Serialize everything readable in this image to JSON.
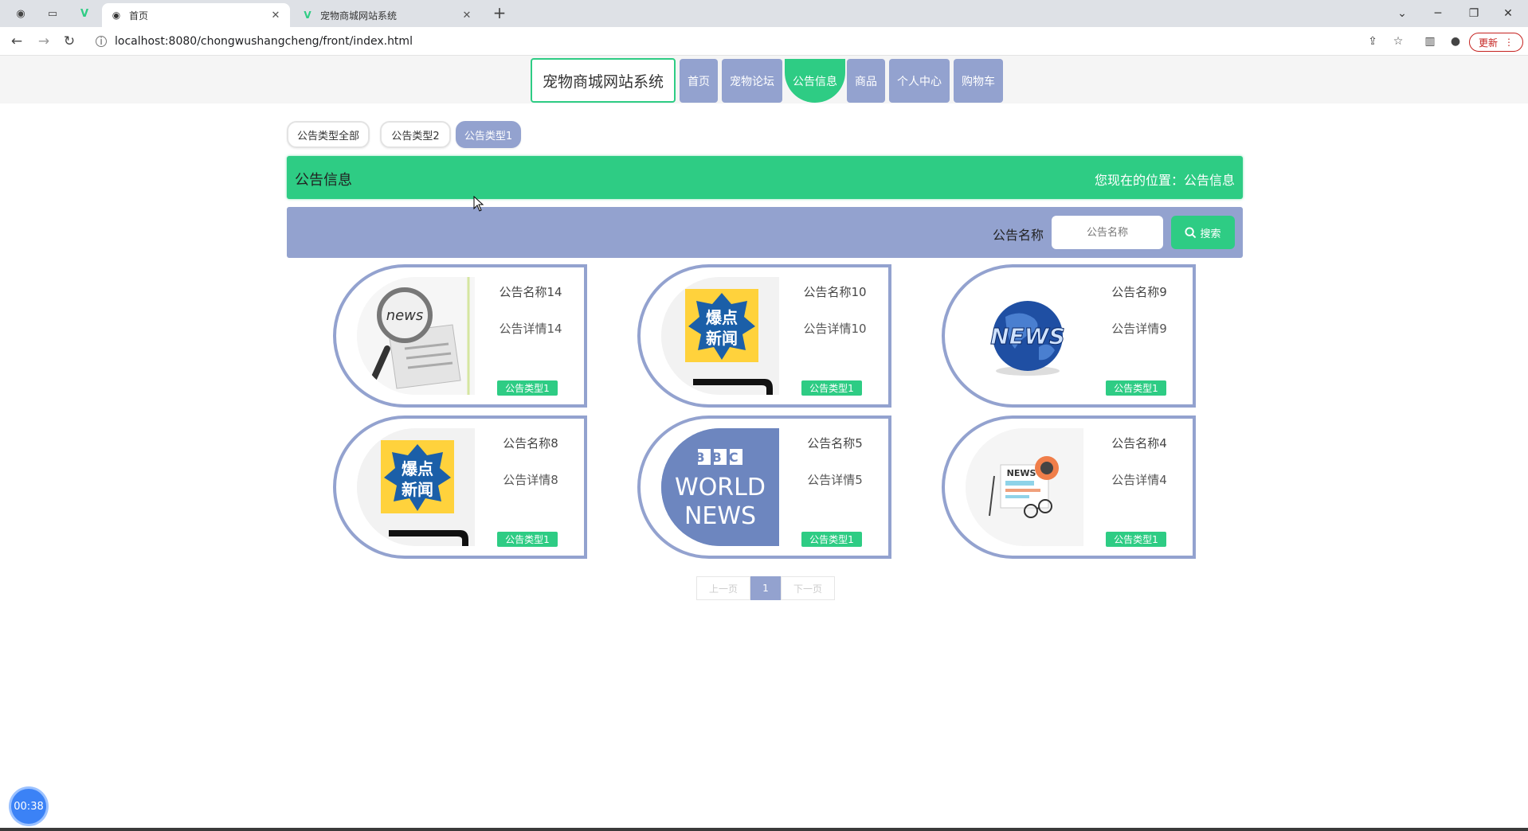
{
  "browser": {
    "tabs": [
      {
        "title": "首页",
        "active": true
      },
      {
        "title": "宠物商城网站系统",
        "active": false
      }
    ],
    "url": "localhost:8080/chongwushangcheng/front/index.html",
    "update_label": "更新"
  },
  "header": {
    "brand": "宠物商城网站系统",
    "menu": [
      {
        "label": "首页",
        "active": false
      },
      {
        "label": "宠物论坛",
        "active": false
      },
      {
        "label": "公告信息",
        "active": true
      },
      {
        "label": "商品",
        "active": false
      },
      {
        "label": "个人中心",
        "active": false
      },
      {
        "label": "购物车",
        "active": false
      }
    ]
  },
  "filters": [
    {
      "label": "公告类型全部",
      "active": false
    },
    {
      "label": "公告类型2",
      "active": false
    },
    {
      "label": "公告类型1",
      "active": true
    }
  ],
  "banner": {
    "title": "公告信息",
    "location": "您现在的位置：公告信息"
  },
  "search": {
    "label": "公告名称",
    "placeholder": "公告名称",
    "button": "搜索"
  },
  "cards": [
    {
      "title": "公告名称14",
      "detail": "公告详情14",
      "tag": "公告类型1",
      "image": "news-magnifier"
    },
    {
      "title": "公告名称10",
      "detail": "公告详情10",
      "tag": "公告类型1",
      "image": "breaking-news-phone"
    },
    {
      "title": "公告名称9",
      "detail": "公告详情9",
      "tag": "公告类型1",
      "image": "news-globe"
    },
    {
      "title": "公告名称8",
      "detail": "公告详情8",
      "tag": "公告类型1",
      "image": "breaking-news-phone"
    },
    {
      "title": "公告名称5",
      "detail": "公告详情5",
      "tag": "公告类型1",
      "image": "bbc-world-news"
    },
    {
      "title": "公告名称4",
      "detail": "公告详情4",
      "tag": "公告类型1",
      "image": "newspaper-glasses"
    }
  ],
  "image_text": {
    "news": "news",
    "breaking_1": "爆点",
    "breaking_2": "新闻",
    "globe": "NEWS",
    "bbc": "BBC",
    "world": "WORLD",
    "bbc_news": "NEWS",
    "paper": "NEWS"
  },
  "pager": {
    "prev": "上一页",
    "current": "1",
    "next": "下一页"
  },
  "timer": "00:38",
  "colors": {
    "primary": "#2ecc84",
    "secondary": "#93a2cf"
  }
}
